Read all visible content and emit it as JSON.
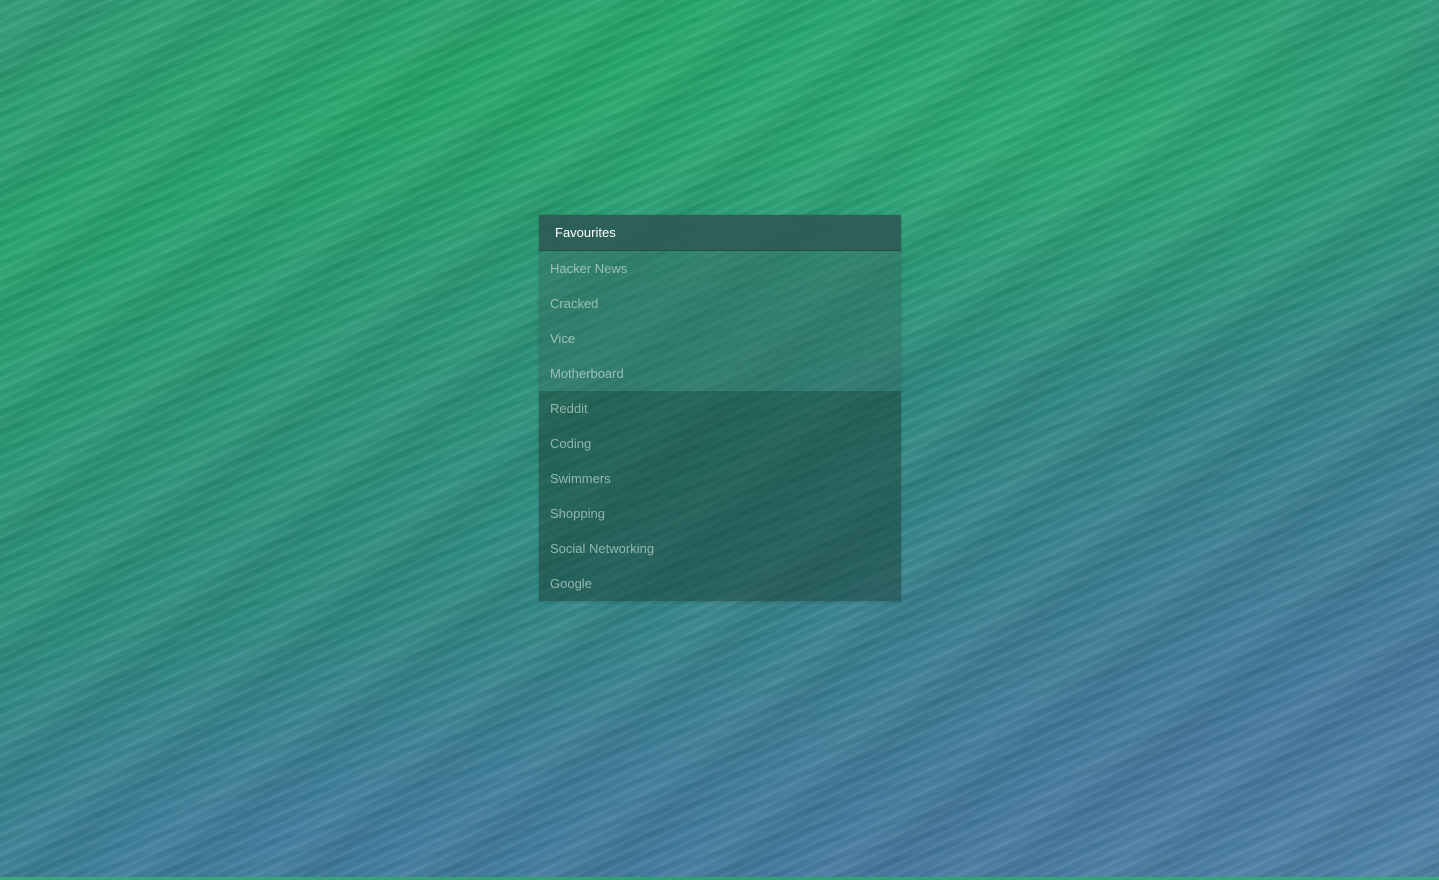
{
  "menu": {
    "title": "Favourites",
    "group_a": [
      {
        "label": "Hacker News"
      },
      {
        "label": "Cracked"
      },
      {
        "label": "Vice"
      },
      {
        "label": "Motherboard"
      }
    ],
    "group_b": [
      {
        "label": "Reddit"
      },
      {
        "label": "Coding"
      },
      {
        "label": "Swimmers"
      },
      {
        "label": "Shopping"
      },
      {
        "label": "Social Networking"
      },
      {
        "label": "Google"
      }
    ]
  },
  "colors": {
    "header_bg": "#2d5a55",
    "item_text": "#bed7d2",
    "header_text": "#ffffff"
  }
}
